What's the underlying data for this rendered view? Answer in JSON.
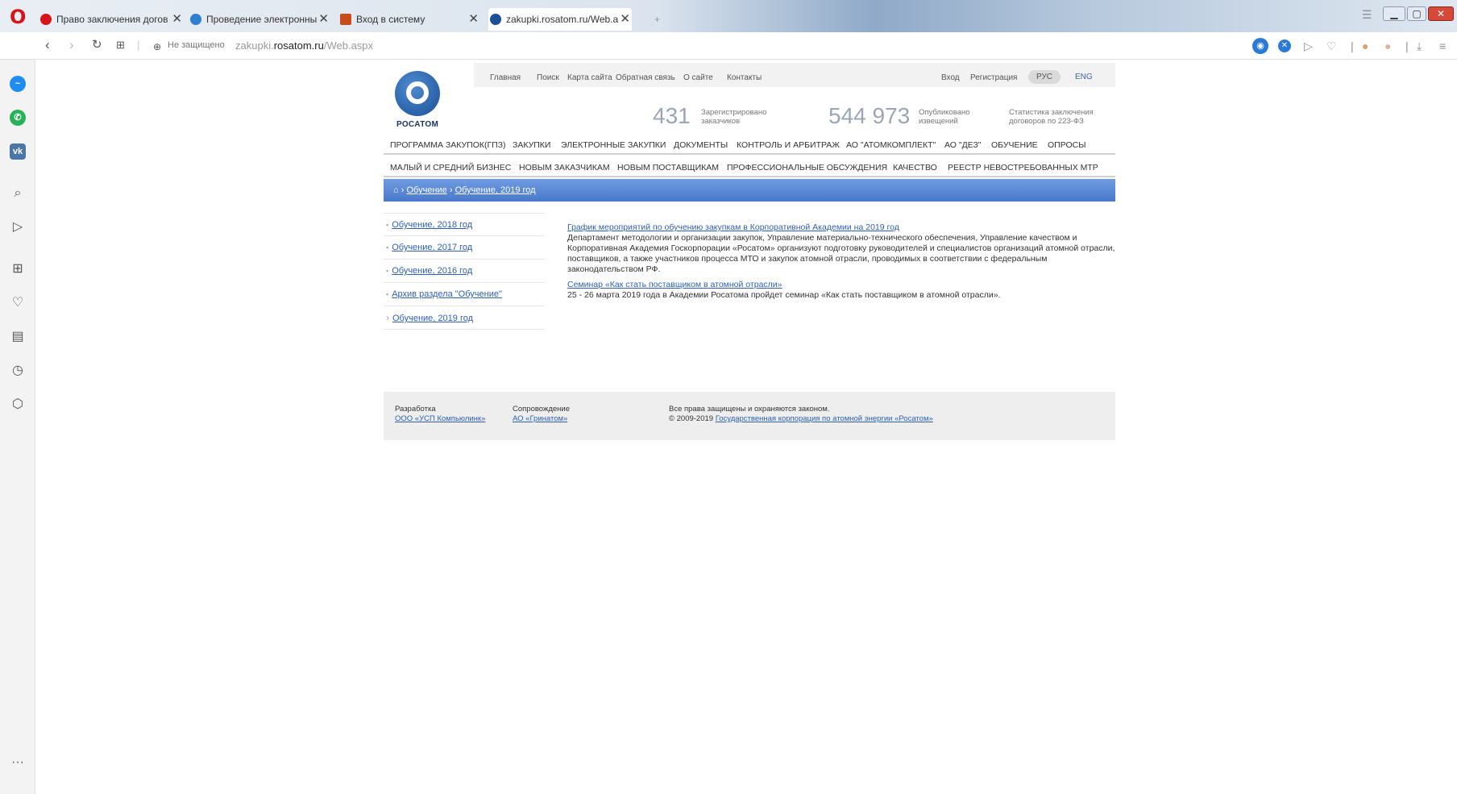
{
  "browser": {
    "tabs": [
      {
        "label": "Право заключения догов",
        "icon_color": "#d7141a"
      },
      {
        "label": "Проведение электронны",
        "icon_color": "#2d7fd0"
      },
      {
        "label": "Вход в систему",
        "icon_color": "#c94b1e"
      },
      {
        "label": "zakupki.rosatom.ru/Web.a",
        "icon_color": "#1b4f96"
      }
    ],
    "ghost_tab_label": "+",
    "security_label": "Не защищено",
    "url_prefix": "zakupki.",
    "url_domain": "rosatom.ru",
    "url_path": "/Web.aspx",
    "icons": [
      "back-icon",
      "forward-icon",
      "reload-icon",
      "speed-dial-icon",
      "globe-icon",
      "camera-icon",
      "vpn-icon",
      "send-icon",
      "heart-icon",
      "download-icon",
      "menu-icon"
    ],
    "sidebar_icons": [
      "messenger-icon",
      "whatsapp-icon",
      "vk-icon",
      "search-icon",
      "send-icon",
      "speed-dial-icon",
      "heart-icon",
      "news-icon",
      "history-icon",
      "extensions-icon",
      "more-icon"
    ]
  },
  "site": {
    "logo_text": "РОСАТОМ",
    "top_menu": [
      "Главная",
      "Поиск",
      "Карта сайта",
      "Обратная связь",
      "О сайте",
      "Контакты"
    ],
    "login": "Вход",
    "register": "Регистрация",
    "lang_ru": "РУС",
    "lang_en": "ENG",
    "stats": [
      {
        "value": "431",
        "label": "Зарегистрировано заказчиков"
      },
      {
        "value": "544 973",
        "label": "Опубликовано извещений"
      }
    ],
    "stats_link": "Статистика заключения договоров по 223-ФЗ",
    "main_nav": [
      "ПРОГРАММА ЗАКУПОК(ГПЗ)",
      "ЗАКУПКИ",
      "ЭЛЕКТРОННЫЕ ЗАКУПКИ",
      "ДОКУМЕНТЫ",
      "КОНТРОЛЬ И АРБИТРАЖ",
      "АО \"АТОМКОМПЛЕКТ\"",
      "АО \"ДЕЗ\"",
      "ОБУЧЕНИЕ",
      "ОПРОСЫ"
    ],
    "sub_nav": [
      "МАЛЫЙ И СРЕДНИЙ БИЗНЕС",
      "НОВЫМ ЗАКАЗЧИКАМ",
      "НОВЫМ ПОСТАВЩИКАМ",
      "ПРОФЕССИОНАЛЬНЫЕ ОБСУЖДЕНИЯ",
      "КАЧЕСТВО",
      "РЕЕСТР НЕВОСТРЕБОВАННЫХ МТР"
    ],
    "breadcrumb": {
      "home_icon": "home-icon",
      "sep": "›",
      "items": [
        "Обучение",
        "Обучение, 2019 год"
      ]
    },
    "left_menu": [
      {
        "label": "Обучение, 2018 год",
        "marker": "▪"
      },
      {
        "label": "Обучение, 2017 год",
        "marker": "▪"
      },
      {
        "label": "Обучение, 2016 год",
        "marker": "▪"
      },
      {
        "label": "Архив раздела \"Обучение\"",
        "marker": "▪"
      },
      {
        "label": "Обучение, 2019 год",
        "marker": "›"
      }
    ],
    "articles": [
      {
        "title": "График мероприятий по обучению закупкам в Корпоративной Академии на 2019 год",
        "text": "Департамент методологии и организации закупок, Управление материально-технического обеспечения, Управление качеством и Корпоративная Академия Госкорпорации «Росатом» организуют подготовку руководителей и специалистов организаций атомной отрасли, поставщиков, а также участников процесса МТО и закупок атомной отрасли, проводимых в соответствии с федеральным законодательством РФ."
      },
      {
        "title": "Семинар «Как стать поставщиком в атомной отрасли»",
        "text": "25 - 26 марта 2019 года в Академии Росатома пройдет семинар «Как стать поставщиком в атомной отрасли»."
      }
    ],
    "footer": {
      "dev_label": "Разработка",
      "dev_link": "ООО «УСП Компьюлинк»",
      "support_label": "Сопровождение",
      "support_link": "АО «Гринатом»",
      "rights": "Все права защищены и охраняются законом.",
      "copyright": "© 2009-2019",
      "corp_link": "Государственная корпорация по атомной энергии «Росатом»"
    }
  }
}
